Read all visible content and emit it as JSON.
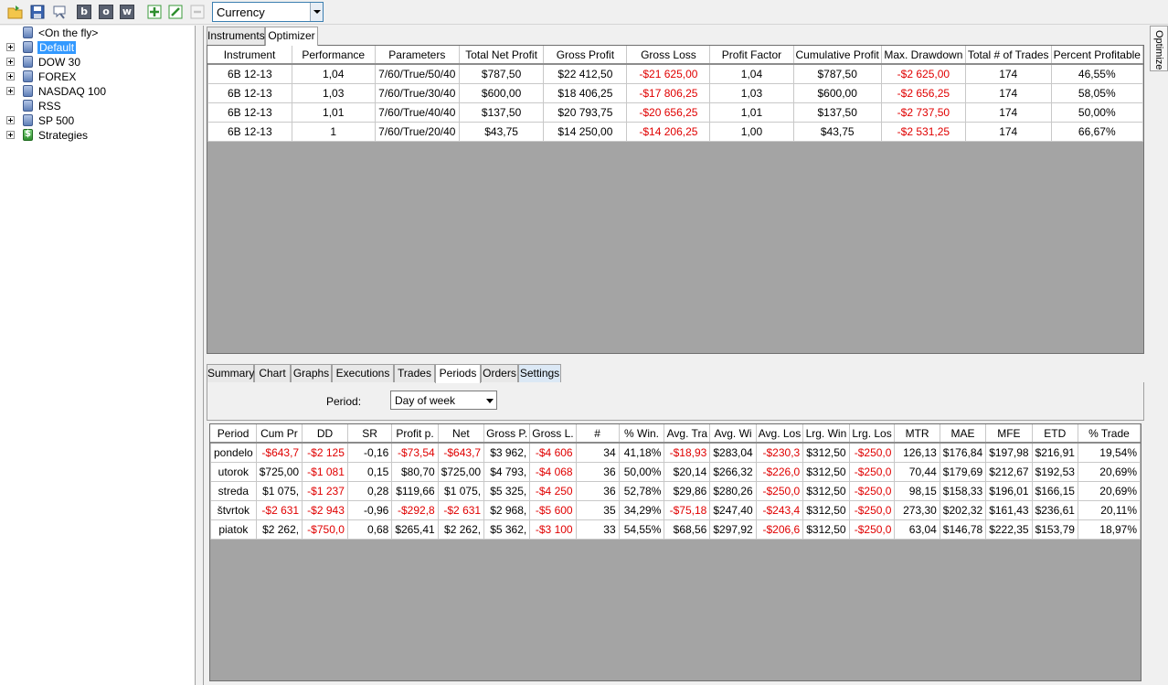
{
  "toolbar": {
    "icons": [
      "open-folder-icon",
      "save-icon",
      "broom-icon",
      "b-icon",
      "o-icon",
      "w-icon",
      "add-icon",
      "edit-icon",
      "delete-icon"
    ],
    "letters": {
      "b": "b",
      "o": "o",
      "w": "w"
    },
    "combo_value": "Currency"
  },
  "tree": [
    {
      "label": "<On the fly>",
      "expander": false,
      "icon": "db"
    },
    {
      "label": "Default",
      "expander": true,
      "icon": "db",
      "selected": true
    },
    {
      "label": "DOW 30",
      "expander": true,
      "icon": "db"
    },
    {
      "label": "FOREX",
      "expander": true,
      "icon": "db"
    },
    {
      "label": "NASDAQ 100",
      "expander": true,
      "icon": "db"
    },
    {
      "label": "RSS",
      "expander": false,
      "icon": "db"
    },
    {
      "label": "SP 500",
      "expander": true,
      "icon": "db"
    },
    {
      "label": "Strategies",
      "expander": true,
      "icon": "strategy"
    }
  ],
  "side_tab": "Optimize",
  "top_tabs": [
    "Instruments",
    "Optimizer"
  ],
  "optimizer": {
    "columns": [
      "Instrument",
      "Performance",
      "Parameters",
      "Total Net Profit",
      "Gross Profit",
      "Gross Loss",
      "Profit Factor",
      "Cumulative Profit",
      "Max. Drawdown",
      "Total # of Trades",
      "Percent Profitable"
    ],
    "rows": [
      [
        "6B 12-13",
        "1,04",
        "7/60/True/50/40",
        "$787,50",
        "$22 412,50",
        "-$21 625,00",
        "1,04",
        "$787,50",
        "-$2 625,00",
        "174",
        "46,55%"
      ],
      [
        "6B 12-13",
        "1,03",
        "7/60/True/30/40",
        "$600,00",
        "$18 406,25",
        "-$17 806,25",
        "1,03",
        "$600,00",
        "-$2 656,25",
        "174",
        "58,05%"
      ],
      [
        "6B 12-13",
        "1,01",
        "7/60/True/40/40",
        "$137,50",
        "$20 793,75",
        "-$20 656,25",
        "1,01",
        "$137,50",
        "-$2 737,50",
        "174",
        "50,00%"
      ],
      [
        "6B 12-13",
        "1",
        "7/60/True/20/40",
        "$43,75",
        "$14 250,00",
        "-$14 206,25",
        "1,00",
        "$43,75",
        "-$2 531,25",
        "174",
        "66,67%"
      ]
    ]
  },
  "bottom_tabs": [
    "Summary",
    "Chart",
    "Graphs",
    "Executions",
    "Trades",
    "Periods",
    "Orders",
    "Settings"
  ],
  "period": {
    "label": "Period:",
    "value": "Day of week"
  },
  "periods": {
    "columns": [
      "Period",
      "Cum Pr",
      "DD",
      "SR",
      "Profit p.",
      "Net",
      "Gross P.",
      "Gross L.",
      "#",
      "% Win.",
      "Avg. Tra",
      "Avg. Wi",
      "Avg. Los",
      "Lrg. Win",
      "Lrg. Los",
      "MTR",
      "MAE",
      "MFE",
      "ETD",
      "% Trade"
    ],
    "rows": [
      [
        "pondelo",
        "-$643,7",
        "-$2 125",
        "-0,16",
        "-$73,54",
        "-$643,7",
        "$3 962,",
        "-$4 606",
        "34",
        "41,18%",
        "-$18,93",
        "$283,04",
        "-$230,3",
        "$312,50",
        "-$250,0",
        "126,13",
        "$176,84",
        "$197,98",
        "$216,91",
        "19,54%"
      ],
      [
        "utorok",
        "$725,00",
        "-$1 081",
        "0,15",
        "$80,70",
        "$725,00",
        "$4 793,",
        "-$4 068",
        "36",
        "50,00%",
        "$20,14",
        "$266,32",
        "-$226,0",
        "$312,50",
        "-$250,0",
        "70,44",
        "$179,69",
        "$212,67",
        "$192,53",
        "20,69%"
      ],
      [
        "streda",
        "$1 075,",
        "-$1 237",
        "0,28",
        "$119,66",
        "$1 075,",
        "$5 325,",
        "-$4 250",
        "36",
        "52,78%",
        "$29,86",
        "$280,26",
        "-$250,0",
        "$312,50",
        "-$250,0",
        "98,15",
        "$158,33",
        "$196,01",
        "$166,15",
        "20,69%"
      ],
      [
        "štvrtok",
        "-$2 631",
        "-$2 943",
        "-0,96",
        "-$292,8",
        "-$2 631",
        "$2 968,",
        "-$5 600",
        "35",
        "34,29%",
        "-$75,18",
        "$247,40",
        "-$243,4",
        "$312,50",
        "-$250,0",
        "273,30",
        "$202,32",
        "$161,43",
        "$236,61",
        "20,11%"
      ],
      [
        "piatok",
        "$2 262,",
        "-$750,0",
        "0,68",
        "$265,41",
        "$2 262,",
        "$5 362,",
        "-$3 100",
        "33",
        "54,55%",
        "$68,56",
        "$297,92",
        "-$206,6",
        "$312,50",
        "-$250,0",
        "63,04",
        "$146,78",
        "$222,35",
        "$153,79",
        "18,97%"
      ]
    ]
  },
  "colors": {
    "negative": "#e00000",
    "selection": "#3399ff",
    "grid_bg": "#a4a4a4"
  }
}
